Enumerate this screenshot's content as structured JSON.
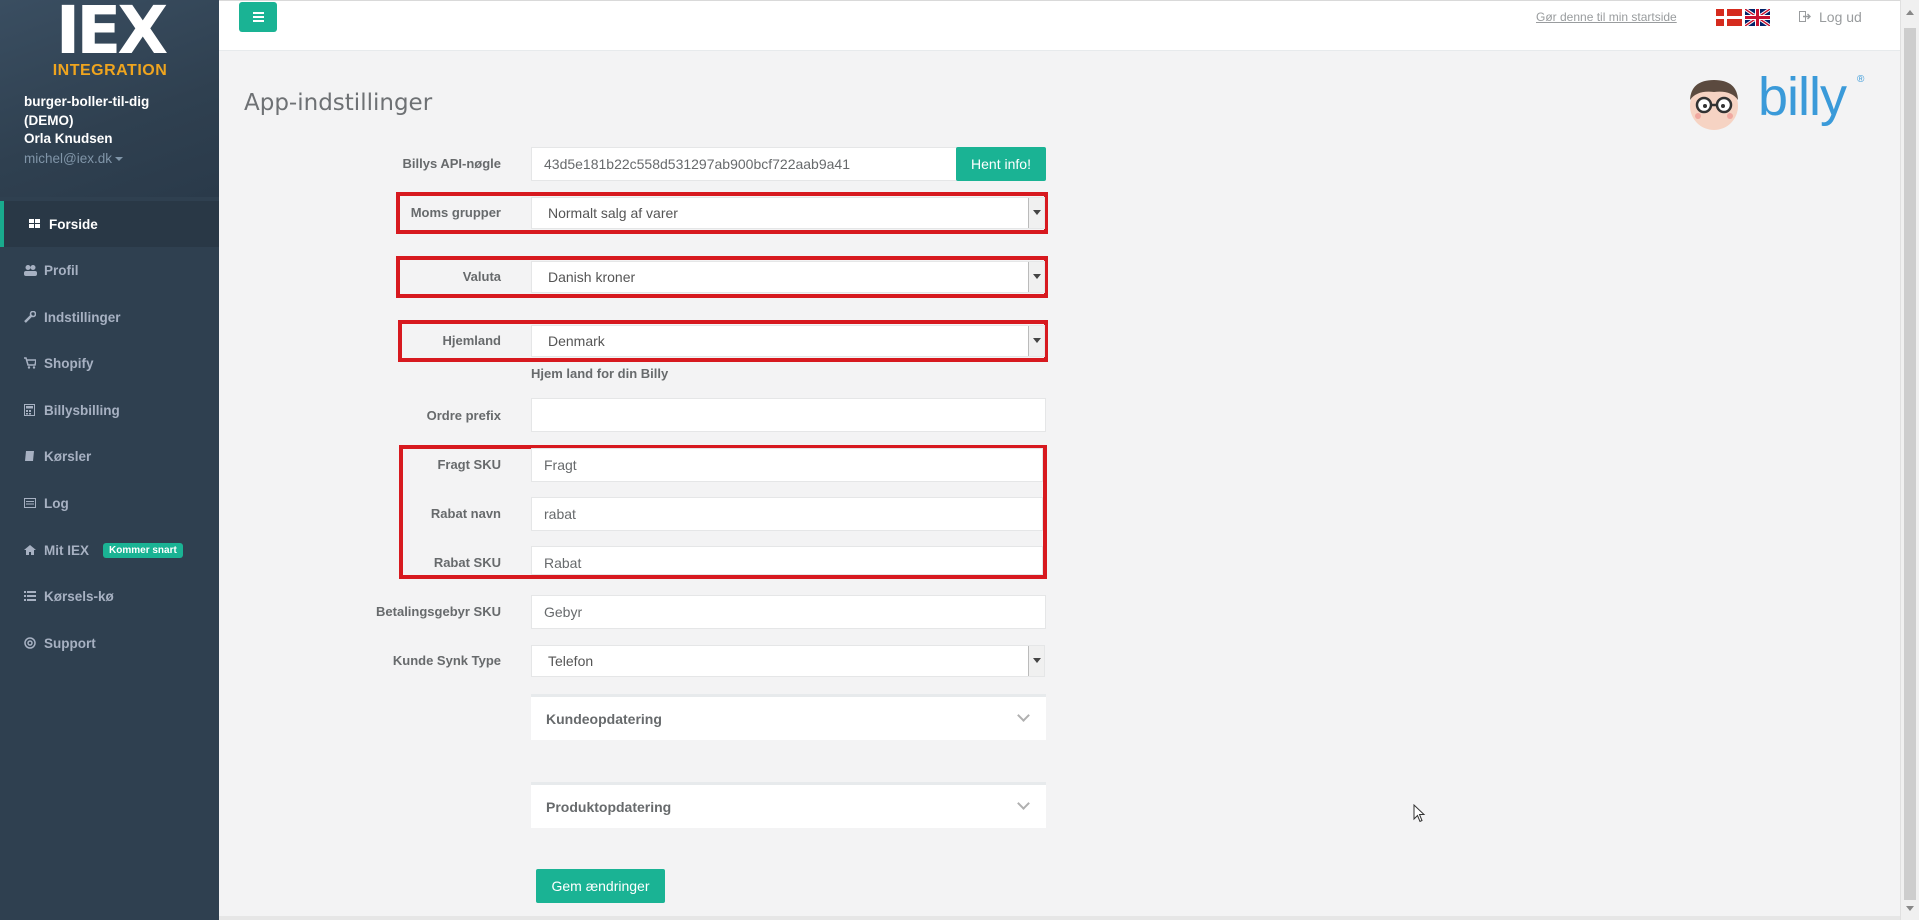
{
  "sidebar": {
    "logo_main": "IEX",
    "logo_sub": "INTEGRATION",
    "company_line1": "burger-boller-til-dig",
    "company_line2": "(DEMO)",
    "user_name": "Orla Knudsen",
    "user_email": "michel@iex.dk",
    "items": [
      {
        "label": "Forside",
        "icon": "dashboard-icon"
      },
      {
        "label": "Profil",
        "icon": "users-icon"
      },
      {
        "label": "Indstillinger",
        "icon": "wrench-icon"
      },
      {
        "label": "Shopify",
        "icon": "cart-icon"
      },
      {
        "label": "Billysbilling",
        "icon": "calculator-icon"
      },
      {
        "label": "Kørsler",
        "icon": "book-icon"
      },
      {
        "label": "Log",
        "icon": "list-alt-icon"
      },
      {
        "label": "Mit IEX",
        "icon": "home-icon",
        "badge": "Kommer snart"
      },
      {
        "label": "Kørsels-kø",
        "icon": "list-icon"
      },
      {
        "label": "Support",
        "icon": "lifebuoy-icon"
      }
    ]
  },
  "topbar": {
    "startside_link": "Gør denne til min startside",
    "logout": "Log ud"
  },
  "page": {
    "title": "App-indstillinger",
    "brand": "billy",
    "brand_reg": "®"
  },
  "form": {
    "api_key_label": "Billys API-nøgle",
    "api_key_value": "43d5e181b22c558d531297ab900bcf722aab9a41",
    "hent_info": "Hent info!",
    "moms_label": "Moms grupper",
    "moms_value": "Normalt salg af varer",
    "valuta_label": "Valuta",
    "valuta_value": "Danish kroner",
    "hjemland_label": "Hjemland",
    "hjemland_value": "Denmark",
    "hjemland_hint": "Hjem land for din Billy",
    "ordre_prefix_label": "Ordre prefix",
    "ordre_prefix_value": "",
    "fragt_sku_label": "Fragt SKU",
    "fragt_sku_value": "Fragt",
    "rabat_navn_label": "Rabat navn",
    "rabat_navn_value": "rabat",
    "rabat_sku_label": "Rabat SKU",
    "rabat_sku_value": "Rabat",
    "betaling_label": "Betalingsgebyr SKU",
    "betaling_value": "Gebyr",
    "kunde_synk_label": "Kunde Synk Type",
    "kunde_synk_value": "Telefon",
    "panel1": "Kundeopdatering",
    "panel2": "Produktopdatering",
    "save": "Gem ændringer"
  },
  "colors": {
    "accent": "#1ab394",
    "sidebar": "#2f4050",
    "highlight": "#d7191f",
    "billy_blue": "#3a9ad9"
  }
}
